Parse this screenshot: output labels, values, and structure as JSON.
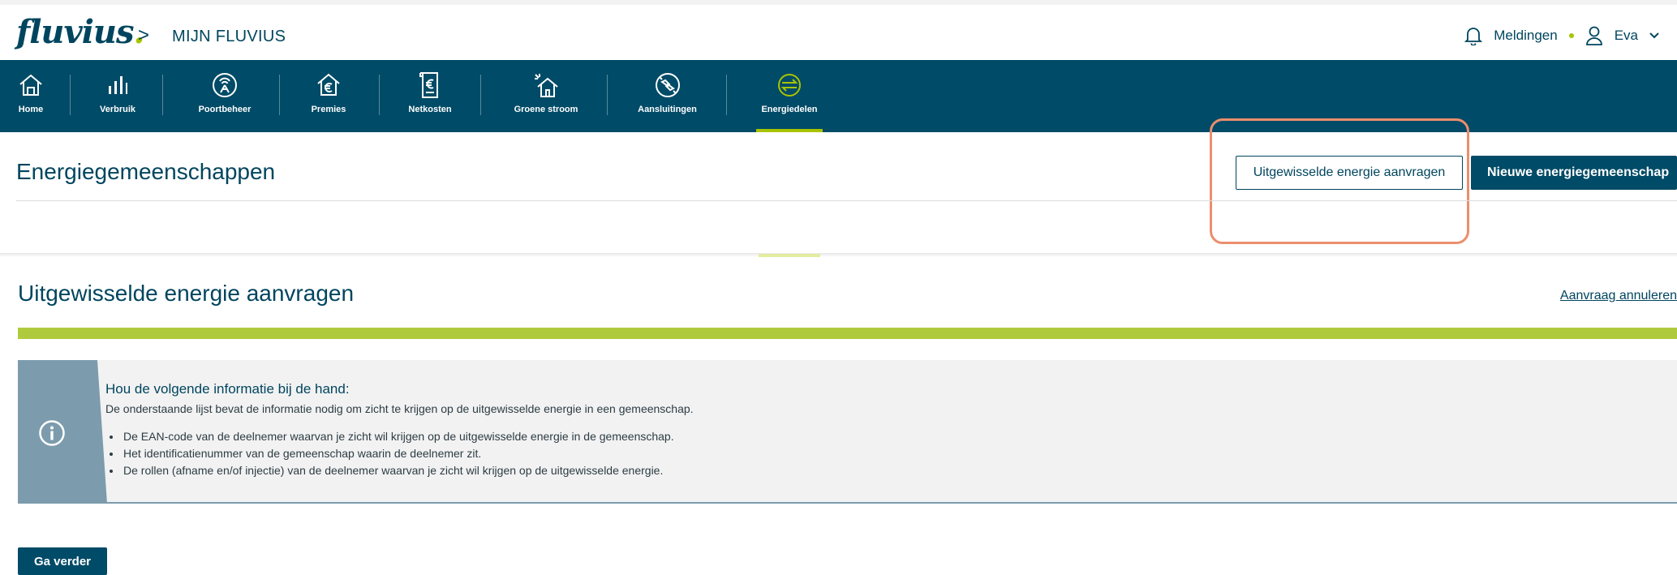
{
  "header": {
    "logo_text": "fluvius",
    "logo_dot": ".",
    "breadcrumb_separator": ">",
    "breadcrumb": "MIJN FLUVIUS",
    "notifications_label": "Meldingen",
    "user_name": "Eva",
    "notification_icon": "bell-icon",
    "user_icon": "user-icon",
    "dropdown_icon": "chevron-down-icon"
  },
  "nav": {
    "items": [
      {
        "label": "Home",
        "icon": "house-icon"
      },
      {
        "label": "Verbruik",
        "icon": "bar-chart-icon"
      },
      {
        "label": "Poortbeheer",
        "icon": "signal-icon"
      },
      {
        "label": "Premies",
        "icon": "house-euro-icon"
      },
      {
        "label": "Netkosten",
        "icon": "invoice-euro-icon"
      },
      {
        "label": "Groene stroom",
        "icon": "solar-house-icon"
      },
      {
        "label": "Aansluitingen",
        "icon": "connection-icon"
      },
      {
        "label": "Energiedelen",
        "icon": "energy-share-icon",
        "active": true
      }
    ]
  },
  "page": {
    "title": "Energiegemeenschappen",
    "btn_request": "Uitgewisselde energie aanvragen",
    "btn_new": "Nieuwe energiegemeenschap"
  },
  "section": {
    "title": "Uitgewisselde energie aanvragen",
    "cancel_link": "Aanvraag annuleren",
    "progress_fraction": 1.0
  },
  "info": {
    "icon": "info-icon",
    "heading": "Hou de volgende informatie bij de hand:",
    "text": "De onderstaande lijst bevat de informatie nodig om zicht te krijgen op de uitgewisselde energie in een gemeenschap.",
    "items": [
      "De EAN-code van de deelnemer waarvan je zicht wil krijgen op de uitgewisselde energie in de gemeenschap.",
      "Het identificatienummer van de gemeenschap waarin de deelnemer zit.",
      "De rollen (afname en/of injectie) van de deelnemer waarvan je zicht wil krijgen op de uitgewisselde energie."
    ]
  },
  "actions": {
    "next": "Ga verder"
  },
  "colors": {
    "primary": "#004b67",
    "accent": "#a8c300",
    "progress": "#b0ca3e",
    "info_side": "#7c9cad",
    "highlight": "#ec8e6c"
  }
}
